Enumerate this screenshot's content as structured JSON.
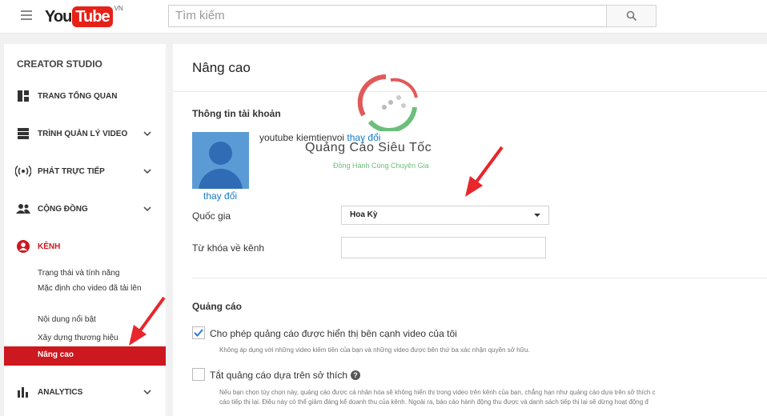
{
  "header": {
    "logo_you": "You",
    "logo_tube": "Tube",
    "logo_region": "VN",
    "search_placeholder": "Tìm kiếm"
  },
  "sidebar": {
    "title": "CREATOR STUDIO",
    "items": [
      {
        "label": "TRANG TỔNG QUAN",
        "icon": "dashboard-icon"
      },
      {
        "label": "TRÌNH QUẢN LÝ VIDEO",
        "icon": "video-manager-icon"
      },
      {
        "label": "PHÁT TRỰC TIẾP",
        "icon": "live-icon"
      },
      {
        "label": "CỘNG ĐỒNG",
        "icon": "community-icon"
      },
      {
        "label": "KÊNH",
        "icon": "channel-icon"
      },
      {
        "label": "ANALYTICS",
        "icon": "analytics-icon"
      }
    ],
    "sub_items": [
      "Trạng thái và tính năng",
      "Mặc định cho video đã tải lên",
      "Nội dung nổi bật",
      "Xây dựng thương hiệu",
      "Nâng cao"
    ]
  },
  "main": {
    "page_title": "Nâng cao",
    "account_section_title": "Thông tin tài khoản",
    "account_name": "youtube kiemtienvoi",
    "change_link": "thay đổi",
    "avatar_change_link": "thay đổi",
    "country_label": "Quốc gia",
    "country_value": "Hoa Kỳ",
    "keywords_label": "Từ khóa về kênh",
    "ads_section_title": "Quảng cáo",
    "ads_option1_label": "Cho phép quảng cáo được hiển thị bên cạnh video của tôi",
    "ads_option1_checked": true,
    "ads_option1_desc": "Không áp dụng với những video kiếm tiền của bạn và những video được bên thứ ba xác nhận quyền sở hữu.",
    "ads_option2_label": "Tắt quảng cáo dựa trên sở thích",
    "ads_option2_checked": false,
    "ads_option2_desc_line1": "Nếu bạn chọn tùy chọn này, quảng cáo được cá nhân hóa sẽ không hiển thị trong video trên kênh của bạn, chẳng hạn như quảng cáo dựa trên sở thích c",
    "ads_option2_desc_line2": "cáo tiếp thị lại. Điều này có thể giảm đáng kể doanh thu của kênh. Ngoài ra, báo cáo hành động thu được và danh sách tiếp thị lại sẽ dừng hoạt động đ"
  },
  "watermark": {
    "name": "Quảng Cáo Siêu Tốc",
    "tagline": "Đồng Hành Cùng Chuyên Gia"
  },
  "colors": {
    "brand_red": "#cc181e",
    "link_blue": "#167ac6",
    "arrow_red": "#e8262b"
  }
}
